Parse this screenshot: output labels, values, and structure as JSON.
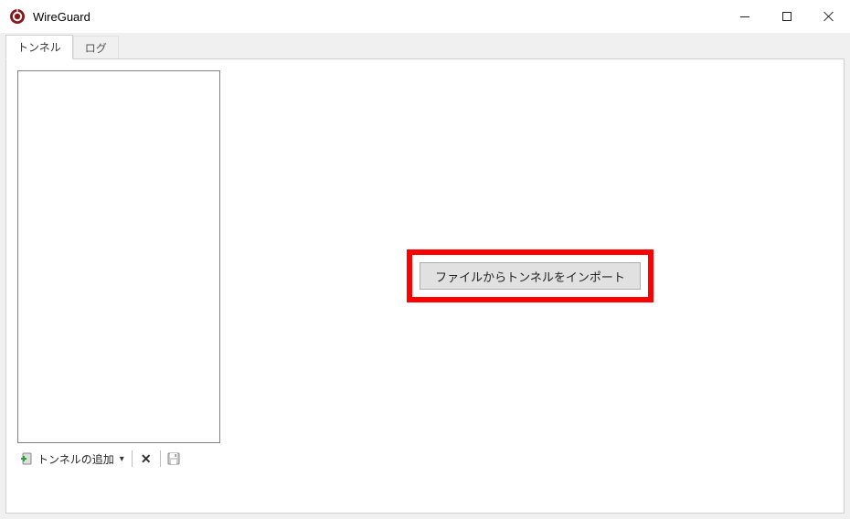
{
  "window": {
    "title": "WireGuard"
  },
  "tabs": {
    "tunnels": "トンネル",
    "log": "ログ"
  },
  "main": {
    "import_button_label": "ファイルからトンネルをインポート"
  },
  "toolbar": {
    "add_tunnel_label": "トンネルの追加"
  },
  "icons": {
    "app": "wireguard-icon",
    "add_plus": "plus-icon",
    "dropdown_chevron": "▾",
    "delete_x": "✕"
  },
  "colors": {
    "highlight": "#ff0000",
    "button_bg": "#e1e1e1",
    "button_border": "#adadad"
  }
}
